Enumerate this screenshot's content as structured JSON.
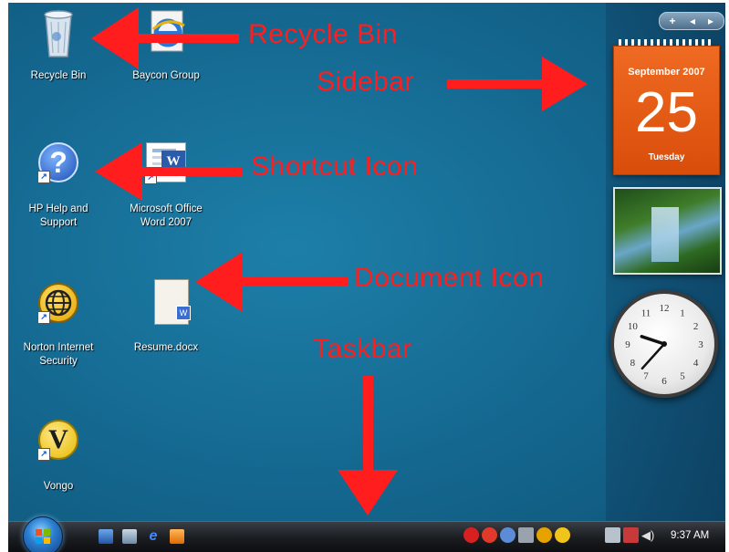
{
  "desktop": {
    "icons": [
      {
        "label": "Recycle Bin",
        "icon": "recycle-bin-icon"
      },
      {
        "label": "Baycon Group",
        "icon": "internet-explorer-icon"
      },
      {
        "label": "HP Help and Support",
        "label_line1": "HP Help and",
        "label_line2": "Support",
        "icon": "help-icon"
      },
      {
        "label": "Microsoft Office Word 2007",
        "label_line1": "Microsoft Office",
        "label_line2": "Word 2007",
        "icon": "word-document-icon"
      },
      {
        "label": "Norton Internet Security",
        "label_line1": "Norton Internet",
        "label_line2": "Security",
        "icon": "norton-globe-icon"
      },
      {
        "label": "Resume.docx",
        "icon": "document-icon"
      },
      {
        "label": "Vongo",
        "icon": "vongo-icon"
      }
    ]
  },
  "annotations": {
    "recycle_bin": "Recycle Bin",
    "sidebar": "Sidebar",
    "shortcut_icon": "Shortcut Icon",
    "document_icon": "Document Icon",
    "taskbar": "Taskbar",
    "color": "#ff1d1d"
  },
  "sidebar": {
    "controls": [
      "+",
      "◂",
      "▸"
    ],
    "calendar": {
      "month": "September 2007",
      "day": "25",
      "weekday": "Tuesday",
      "color": "#e65a12"
    },
    "slideshow": {
      "icon": "waterfall-photo"
    },
    "clock": {
      "hour": 9,
      "minute": 37,
      "numerals": [
        "12",
        "1",
        "2",
        "3",
        "4",
        "5",
        "6",
        "7",
        "8",
        "9",
        "10",
        "11"
      ]
    }
  },
  "taskbar": {
    "start_icon": "windows-orb-icon",
    "quick_launch": [
      "show-desktop-icon",
      "switch-windows-icon",
      "internet-explorer-icon",
      "media-player-icon"
    ],
    "tray_icons": [
      "network-alert-icon",
      "security-alert-icon",
      "bluetooth-icon",
      "device-icon",
      "norton-icon",
      "vongo-tray-icon",
      "battery-icon",
      "network-icon",
      "volume-icon"
    ],
    "time": "9:37 AM"
  }
}
